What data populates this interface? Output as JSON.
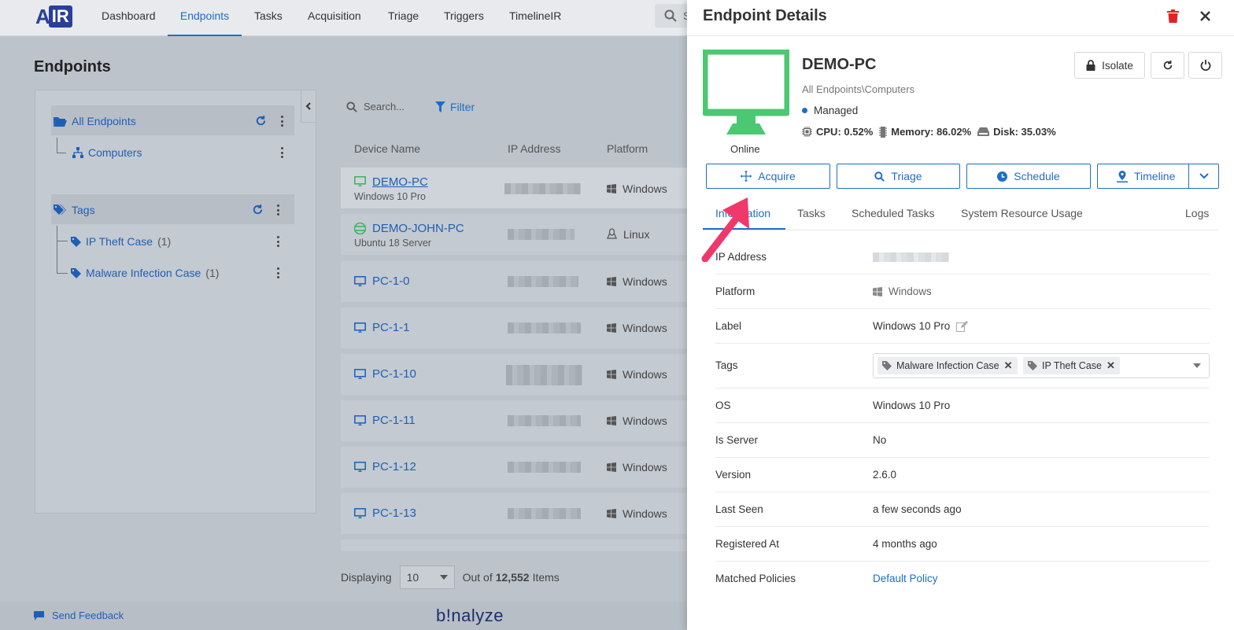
{
  "nav": {
    "logo_a": "A",
    "logo_ir": "IR",
    "items": [
      "Dashboard",
      "Endpoints",
      "Tasks",
      "Acquisition",
      "Triage",
      "Triggers",
      "TimelineIR"
    ],
    "search_stub": "S"
  },
  "endpoints": {
    "title": "Endpoints",
    "tree": {
      "all_endpoints": "All Endpoints",
      "computers": "Computers",
      "tags": "Tags",
      "tag_items": [
        {
          "label": "IP Theft Case",
          "count": "(1)"
        },
        {
          "label": "Malware Infection Case",
          "count": "(1)"
        }
      ]
    },
    "search_placeholder": "Search...",
    "filter_label": "Filter",
    "columns": [
      "Device Name",
      "IP Address",
      "Platform"
    ],
    "rows": [
      {
        "name": "DEMO-PC",
        "sub": "Windows 10 Pro",
        "platform": "Windows"
      },
      {
        "name": "DEMO-JOHN-PC",
        "sub": "Ubuntu 18 Server",
        "platform": "Linux"
      },
      {
        "name": "PC-1-0",
        "sub": "",
        "platform": "Windows"
      },
      {
        "name": "PC-1-1",
        "sub": "",
        "platform": "Windows"
      },
      {
        "name": "PC-1-10",
        "sub": "",
        "platform": "Windows"
      },
      {
        "name": "PC-1-11",
        "sub": "",
        "platform": "Windows"
      },
      {
        "name": "PC-1-12",
        "sub": "",
        "platform": "Windows"
      },
      {
        "name": "PC-1-13",
        "sub": "",
        "platform": "Windows"
      }
    ],
    "displaying_label": "Displaying",
    "page_size": "10",
    "out_of_prefix": "Out of",
    "total": "12,552",
    "items_suffix": "Items"
  },
  "footer": {
    "feedback": "Send Feedback",
    "brand": "b!nalyze"
  },
  "drawer": {
    "title": "Endpoint Details",
    "device": {
      "name": "DEMO-PC",
      "path": "All Endpoints\\Computers",
      "status": "Online",
      "managed": "Managed",
      "cpu": "CPU: 0.52%",
      "memory": "Memory: 86.02%",
      "disk": "Disk: 35.03%"
    },
    "isolate_label": "Isolate",
    "actions": {
      "acquire": "Acquire",
      "triage": "Triage",
      "schedule": "Schedule",
      "timeline": "Timeline"
    },
    "tabs": [
      "Information",
      "Tasks",
      "Scheduled Tasks",
      "System Resource Usage",
      "Logs"
    ],
    "info": {
      "ip_label": "IP Address",
      "platform_label": "Platform",
      "platform_value": "Windows",
      "label_label": "Label",
      "label_value": "Windows 10 Pro",
      "tags_label": "Tags",
      "tags": [
        "Malware Infection Case",
        "IP Theft Case"
      ],
      "os_label": "OS",
      "os_value": "Windows 10 Pro",
      "server_label": "Is Server",
      "server_value": "No",
      "version_label": "Version",
      "version_value": "2.6.0",
      "seen_label": "Last Seen",
      "seen_value": "a few seconds ago",
      "registered_label": "Registered At",
      "registered_value": "4 months ago",
      "policies_label": "Matched Policies",
      "policies_value": "Default Policy"
    }
  },
  "colors": {
    "accent": "#1e6ec8",
    "online_green": "#4cc873",
    "trash_red": "#e02424",
    "arrow_pink": "#f0386b"
  }
}
